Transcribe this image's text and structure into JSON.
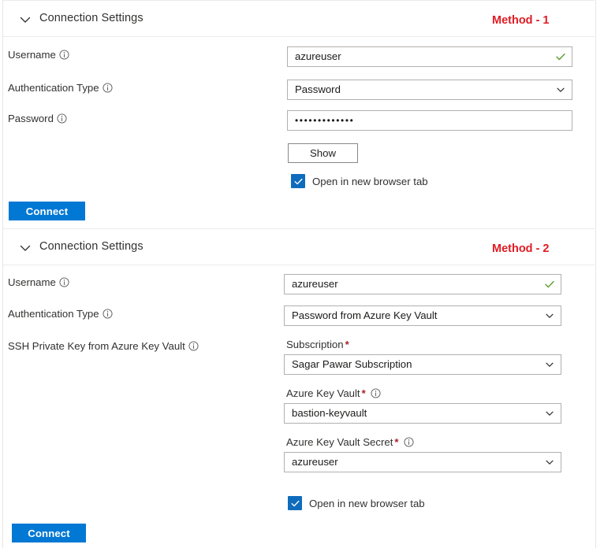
{
  "page": {
    "background_color": "#ffffff",
    "accent_color": "#0078d4",
    "method_tag_color": "#e01b24",
    "required_star_color": "#a4262c",
    "valid_check_color": "#5a9e2f"
  },
  "method1": {
    "header": {
      "title": "Connection Settings",
      "chevron_icon": "chevron-down-icon",
      "method_tag": "Method - 1"
    },
    "username": {
      "label": "Username",
      "info_icon": "info-icon",
      "value": "azureuser",
      "valid_icon": "check-icon"
    },
    "auth_type": {
      "label": "Authentication Type",
      "info_icon": "info-icon",
      "value": "Password",
      "chevron_icon": "chevron-down-icon"
    },
    "password": {
      "label": "Password",
      "info_icon": "info-icon",
      "value": "•••••••••••••"
    },
    "show_button": {
      "label": "Show"
    },
    "open_new_tab": {
      "label": "Open in new browser tab",
      "checked": true,
      "check_icon": "check-icon"
    },
    "connect_button": {
      "label": "Connect"
    }
  },
  "method2": {
    "header": {
      "title": "Connection Settings",
      "chevron_icon": "chevron-down-icon",
      "method_tag": "Method - 2"
    },
    "username": {
      "label": "Username",
      "info_icon": "info-icon",
      "value": "azureuser",
      "valid_icon": "check-icon"
    },
    "auth_type": {
      "label": "Authentication Type",
      "info_icon": "info-icon",
      "value": "Password from Azure Key Vault",
      "chevron_icon": "chevron-down-icon"
    },
    "ssh_key_label": {
      "label": "SSH Private Key from Azure Key Vault",
      "info_icon": "info-icon"
    },
    "subscription": {
      "label": "Subscription",
      "required": "*",
      "value": "Sagar Pawar Subscription",
      "chevron_icon": "chevron-down-icon"
    },
    "key_vault": {
      "label": "Azure Key Vault",
      "required": "*",
      "info_icon": "info-icon",
      "value": "bastion-keyvault",
      "chevron_icon": "chevron-down-icon"
    },
    "key_vault_secret": {
      "label": "Azure Key Vault Secret",
      "required": "*",
      "info_icon": "info-icon",
      "value": "azureuser",
      "chevron_icon": "chevron-down-icon"
    },
    "open_new_tab": {
      "label": "Open in new browser tab",
      "checked": true,
      "check_icon": "check-icon"
    },
    "connect_button": {
      "label": "Connect"
    }
  }
}
